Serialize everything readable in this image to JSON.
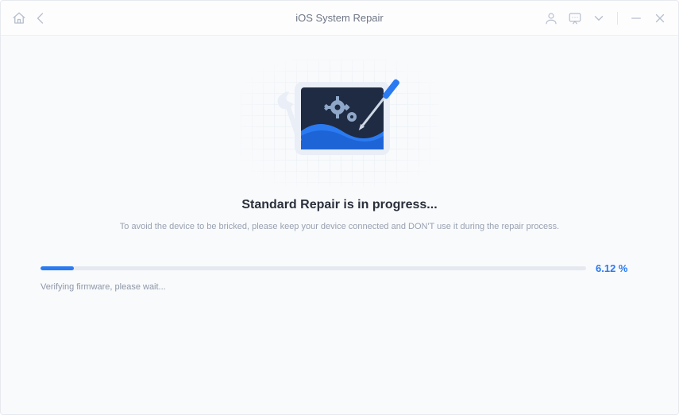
{
  "window": {
    "title": "iOS System Repair"
  },
  "icons": {
    "home": "home-icon",
    "back": "back-icon",
    "user": "user-icon",
    "feedback": "feedback-icon",
    "dropdown": "chevron-down-icon",
    "minimize": "minimize-icon",
    "close": "close-icon"
  },
  "main": {
    "heading": "Standard Repair is in progress...",
    "subtext": "To avoid the device to be bricked, please keep your device connected and DON'T use it during the repair process."
  },
  "progress": {
    "percent_value": 6.12,
    "percent_label": "6.12 %",
    "status": "Verifying firmware, please wait..."
  },
  "colors": {
    "accent": "#2a7af2",
    "track": "#e6e9ef",
    "text_muted": "#9aa1b0"
  }
}
